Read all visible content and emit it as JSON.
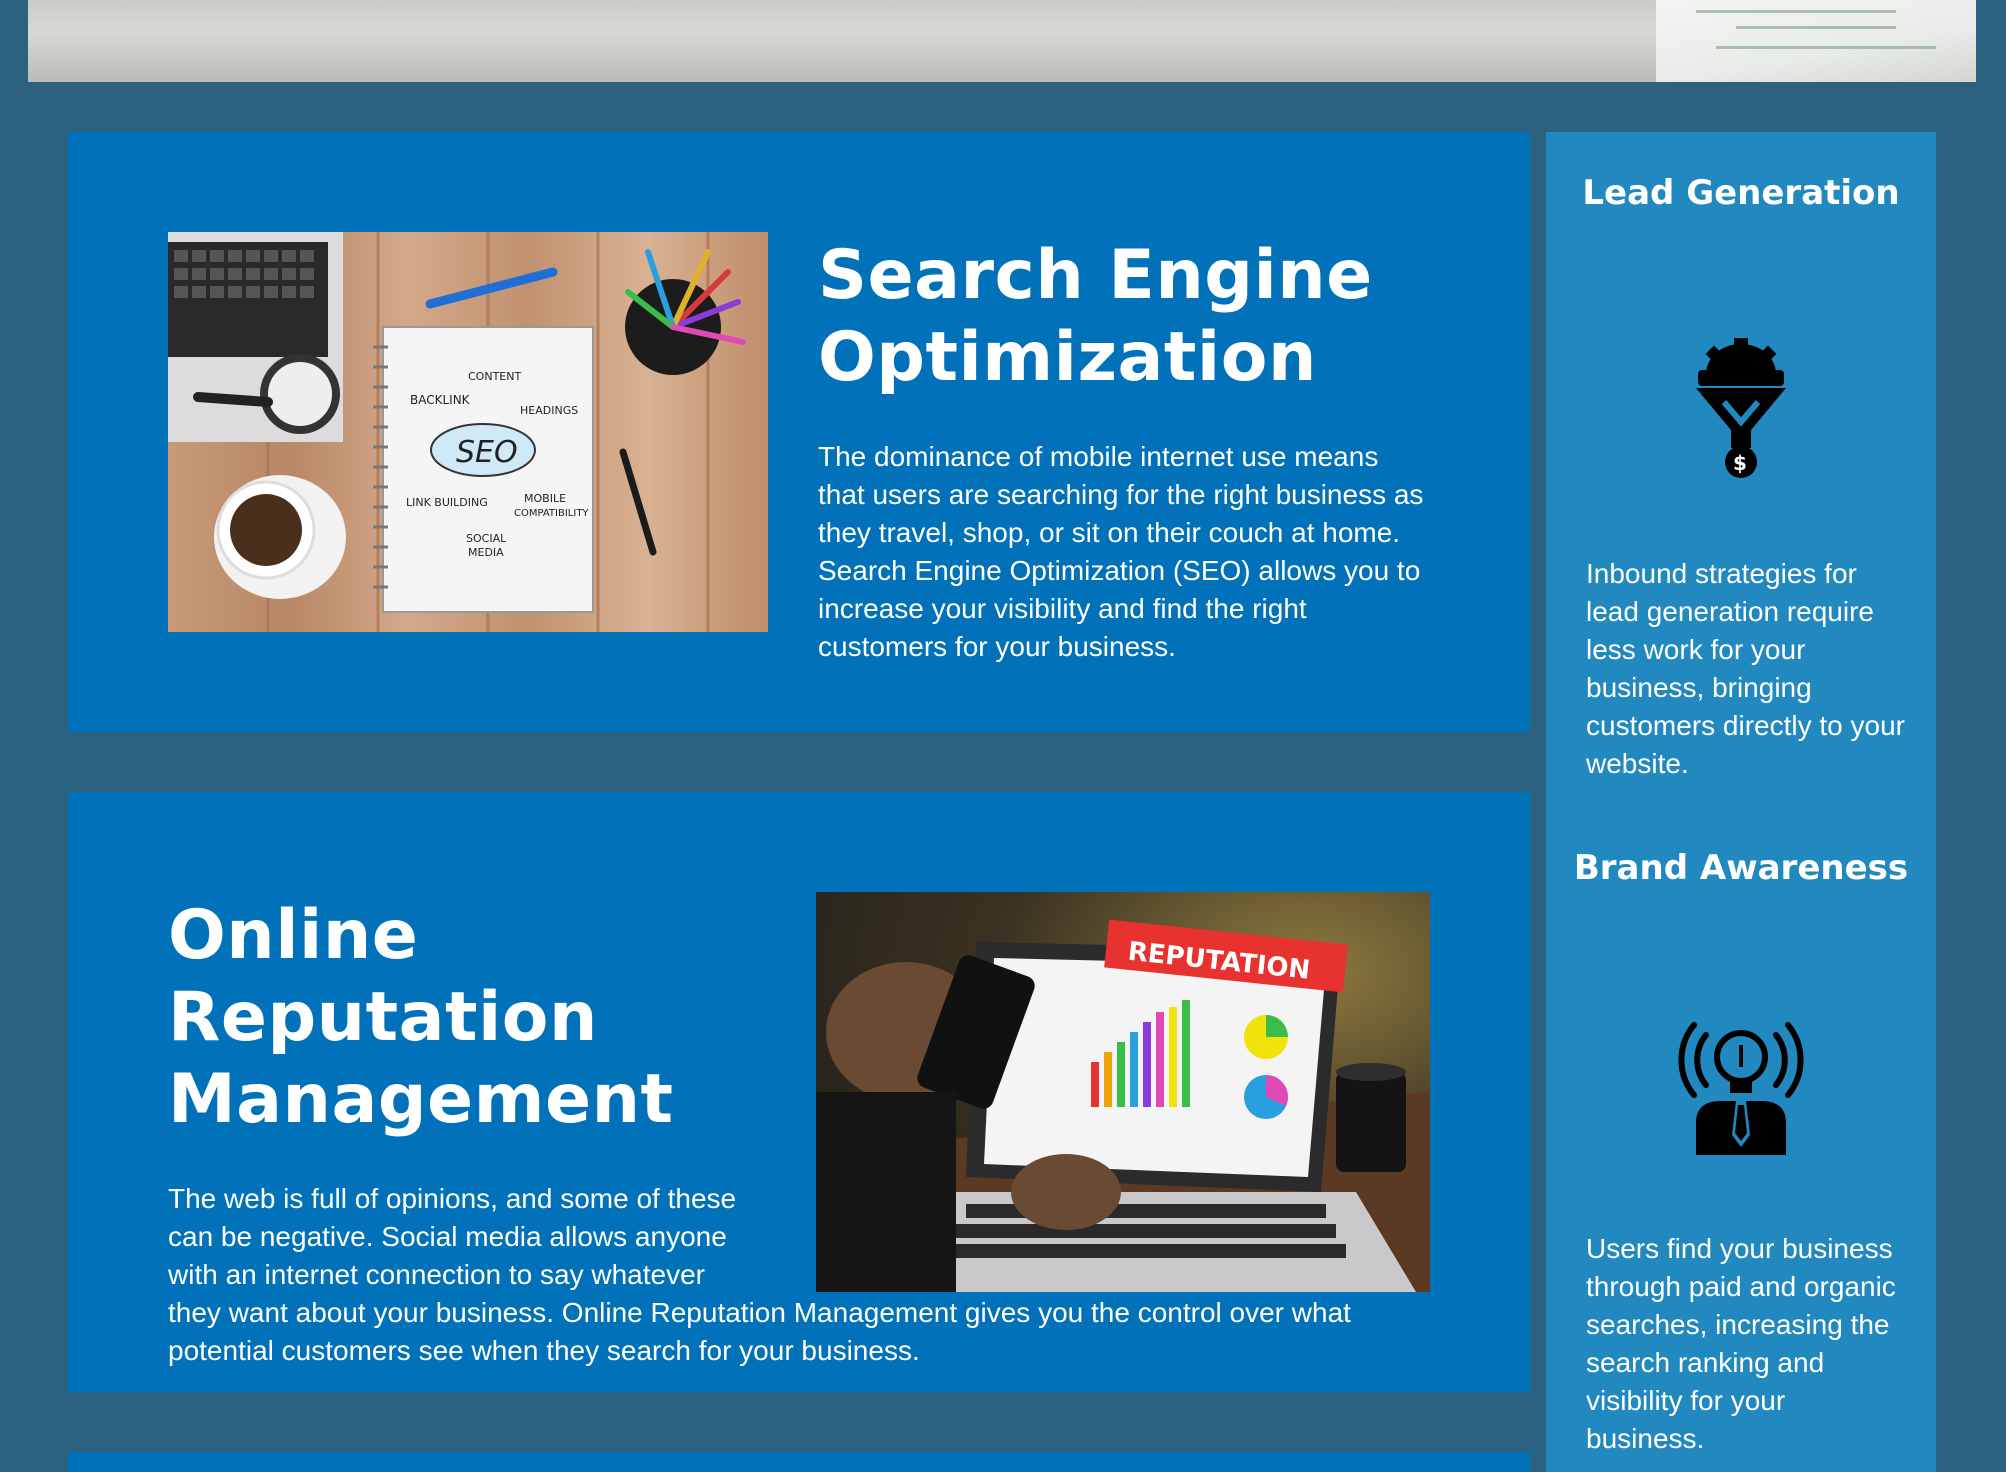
{
  "seo_card": {
    "title": "Search Engine Optimization",
    "description": "The dominance of mobile internet use means that users are searching for the right business as they travel, shop, or sit on their couch at home. Search Engine Optimization (SEO) allows you to increase your visibility and find the right customers for your business.",
    "image_words": {
      "content": "CONTENT",
      "backlink": "BACKLINK",
      "headings": "HEADINGS",
      "seo": "SEO",
      "link_building": "LINK BUILDING",
      "mobile": "MOBILE",
      "compatibility": "COMPATIBILITY",
      "social": "SOCIAL",
      "media": "MEDIA"
    }
  },
  "orm_card": {
    "title": "Online Reputation Management",
    "description_part1": "The web is full of opinions, and some of these can be negative. Social media allows anyone with an internet connection to say whatever",
    "description_part2": "they want about your business. Online Reputation Management gives you the control over what potential customers see when they search for your business.",
    "image_word": "REPUTATION"
  },
  "sidebar": {
    "items": [
      {
        "title": "Lead Generation",
        "icon": "funnel-gear-icon",
        "text": "Inbound strategies for lead generation require less work for your business, bringing customers directly to your website."
      },
      {
        "title": "Brand Awareness",
        "icon": "lightbulb-person-icon",
        "text": "Users find your business through paid and organic searches, increasing the search ranking and visibility for your business."
      }
    ]
  },
  "colors": {
    "page_background": "#2c6180",
    "card_background": "#0172b9",
    "sidebar_background": "#2189bf",
    "text": "#ffffff"
  }
}
